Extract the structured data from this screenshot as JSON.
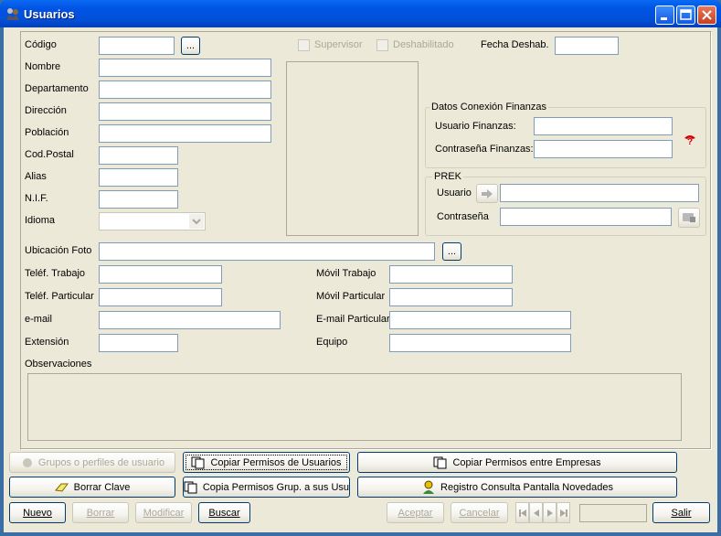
{
  "window": {
    "title": "Usuarios"
  },
  "labels": {
    "codigo": "Código",
    "nombre": "Nombre",
    "departamento": "Departamento",
    "direccion": "Dirección",
    "poblacion": "Población",
    "cod_postal": "Cod.Postal",
    "alias": "Alias",
    "nif": "N.I.F.",
    "idioma": "Idioma",
    "supervisor": "Supervisor",
    "deshabilitado": "Deshabilitado",
    "fecha_deshab": "Fecha Deshab.",
    "ubicacion_foto": "Ubicación Foto",
    "telef_trabajo": "Teléf. Trabajo",
    "telef_particular": "Teléf. Particular",
    "email": "e-mail",
    "extension": "Extensión",
    "movil_trabajo": "Móvil Trabajo",
    "movil_particular": "Móvil Particular",
    "email_particular": "E-mail Particular",
    "equipo": "Equipo",
    "observaciones": "Observaciones"
  },
  "finanzas": {
    "group_label": "Datos Conexión Finanzas",
    "usuario": "Usuario Finanzas:",
    "contrasena": "Contraseña Finanzas:"
  },
  "prek": {
    "group_label": "PREK",
    "usuario": "Usuario",
    "contrasena": "Contraseña"
  },
  "buttons": {
    "browse": "...",
    "grupos": "Grupos o perfiles de usuario",
    "copiar_permisos_usuarios": "Copiar Permisos de Usuarios",
    "copiar_permisos_empresas": "Copiar Permisos entre Empresas",
    "borrar_clave": "Borrar Clave",
    "copia_permisos_grup": "Copia Permisos Grup. a sus Usu",
    "registro_consulta": "Registro Consulta Pantalla Novedades",
    "nuevo": "Nuevo",
    "borrar": "Borrar",
    "modificar": "Modificar",
    "buscar": "Buscar",
    "aceptar": "Aceptar",
    "cancelar": "Cancelar",
    "salir": "Salir"
  },
  "colors": {
    "titlebar": "#0054E3",
    "face": "#ECE9D8",
    "border": "#7F9DB9"
  }
}
